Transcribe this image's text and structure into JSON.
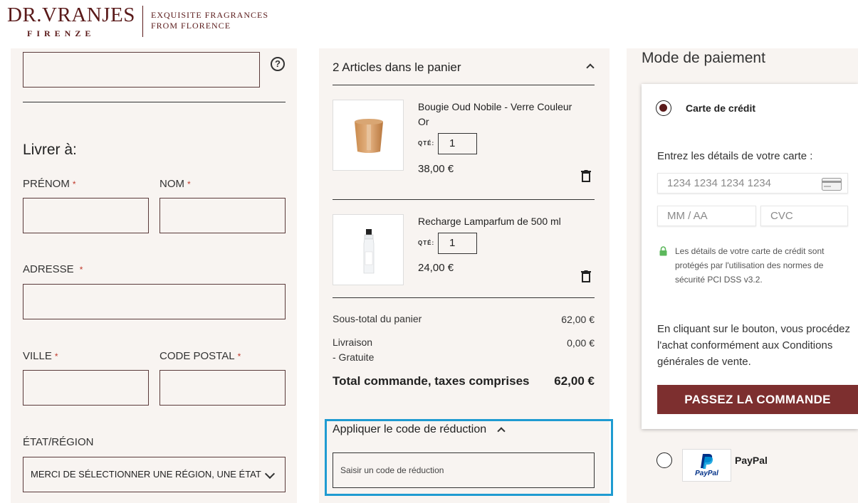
{
  "brand": {
    "logo": "DR.VRANJES",
    "logo_sub": "FIRENZE",
    "tagline_1": "EXQUISITE FRAGRANCES",
    "tagline_2": "FROM FLORENCE"
  },
  "shipping": {
    "heading": "Livrer à:",
    "required_mark": "*",
    "first_name_label": "PRÉNOM",
    "last_name_label": "NOM",
    "address_label": "ADRESSE",
    "city_label": "VILLE",
    "postal_label": "CODE POSTAL",
    "region_label": "ÉTAT/RÉGION",
    "region_selected": "MERCI DE SÉLECTIONNER UNE RÉGION, UNE ÉTAT",
    "help_glyph": "?"
  },
  "cart": {
    "title": "2 Articles dans le panier",
    "qty_label": "QTÉ:",
    "items": [
      {
        "name": "Bougie Oud Nobile - Verre Couleur Or",
        "qty": "1",
        "price": "38,00 €"
      },
      {
        "name": "Recharge Lamparfum de 500 ml",
        "qty": "1",
        "price": "24,00 €"
      }
    ],
    "subtotal_label": "Sous-total du panier",
    "subtotal_value": "62,00 €",
    "shipping_label": "Livraison",
    "shipping_method": "- Gratuite",
    "shipping_value": "0,00 €",
    "total_label": "Total commande, taxes comprises",
    "total_value": "62,00 €"
  },
  "promo": {
    "title": "Appliquer le code de réduction",
    "placeholder": "Saisir un code de réduction"
  },
  "payment": {
    "title": "Mode de paiement",
    "card_option": "Carte de crédit",
    "card_prompt": "Entrez les détails de votre carte :",
    "card_number_placeholder": "1234 1234 1234 1234",
    "expiry_placeholder": "MM / AA",
    "cvc_placeholder": "CVC",
    "security_note": "Les détails de votre carte de crédit sont protégés par l'utilisation des normes de sécurité PCI DSS v3.2.",
    "terms_line_1": "En cliquant sur le bouton, vous procédez",
    "terms_line_2": "l'achat conformément aux Conditions",
    "terms_line_3": "générales de vente.",
    "order_button": "PASSEZ LA COMMANDE",
    "paypal_option": "PayPal",
    "paypal_logo_text": "PayPal"
  },
  "colors": {
    "brand": "#5a1a1a",
    "button": "#7d2f2f",
    "panel_bg": "#f8f4f1",
    "highlight": "#1f9bd1"
  }
}
